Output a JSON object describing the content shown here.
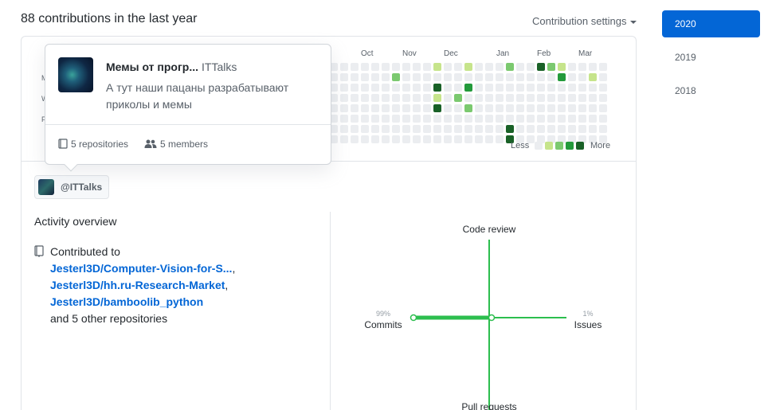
{
  "header": {
    "title": "88 contributions in the last year",
    "settings_label": "Contribution settings"
  },
  "years": [
    "2020",
    "2019",
    "2018"
  ],
  "graph": {
    "months": [
      "Oct",
      "Nov",
      "Dec",
      "Jan",
      "Feb",
      "Mar"
    ],
    "day_labels": [
      "M",
      "W",
      "F"
    ],
    "legend_less": "Less",
    "legend_more": "More",
    "colors": [
      "#ebedf0",
      "#c6e48b",
      "#7bc96f",
      "#239a3b",
      "#196127"
    ]
  },
  "org": {
    "handle": "@ITTalks"
  },
  "tooltip": {
    "name": "Мемы от прогр...",
    "login": "ITTalks",
    "description": "А тут наши пацаны разрабатывают приколы и мемы",
    "repositories": "5 repositories",
    "members": "5 members"
  },
  "activity": {
    "title": "Activity overview",
    "contributed_to": "Contributed to",
    "repos": [
      "Jesterl3D/Computer-Vision-for-S...",
      "Jesterl3D/hh.ru-Research-Market",
      "Jesterl3D/bamboolib_python"
    ],
    "others": "and 5 other repositories"
  },
  "radar": {
    "top": "Code review",
    "bottom": "Pull requests",
    "left_label": "Commits",
    "left_pct": "99%",
    "right_label": "Issues",
    "right_pct": "1%",
    "commits_fraction": 0.99,
    "issues_fraction": 0.01,
    "color": "#2cbe4e"
  }
}
